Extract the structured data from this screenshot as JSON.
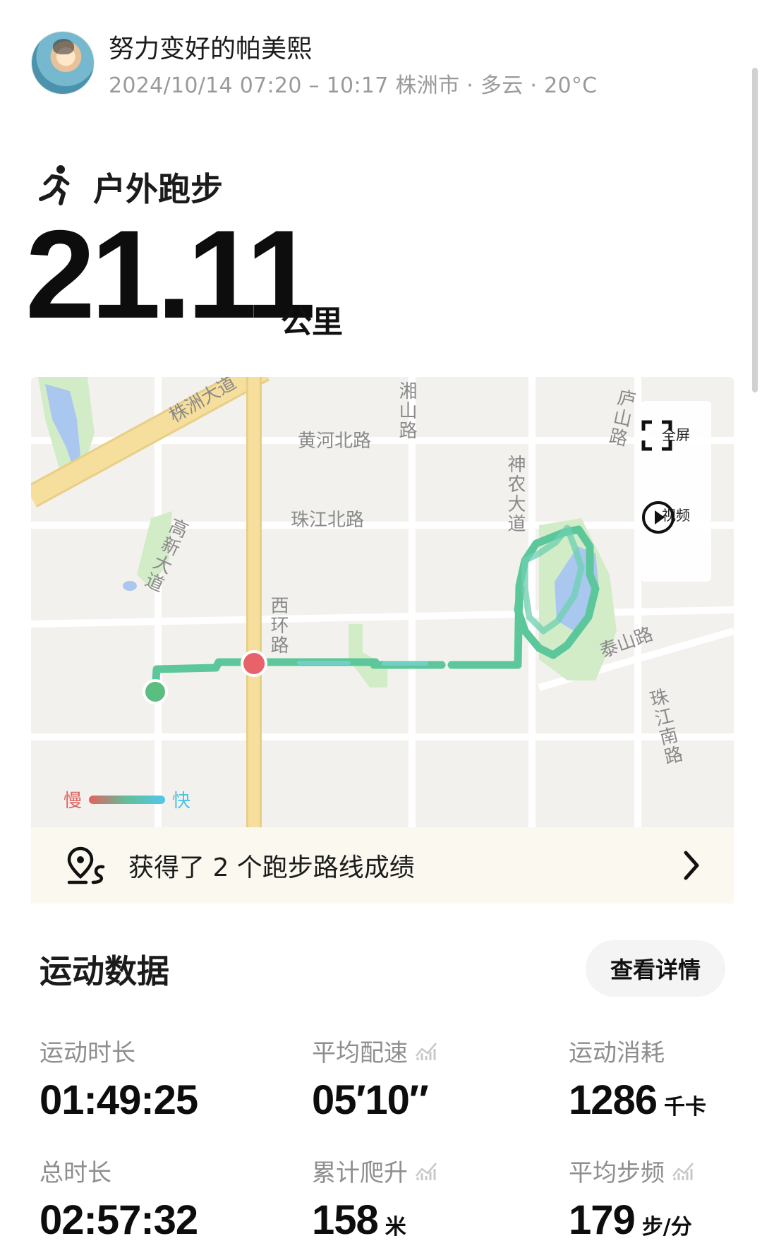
{
  "header": {
    "username": "努力变好的帕美熙",
    "time_range": "2024/10/14 07:20 – 10:17",
    "city": "株洲市",
    "weather": "多云",
    "temperature": "20°C",
    "separator": "·"
  },
  "activity": {
    "icon": "running-person-icon",
    "type": "户外跑步",
    "distance": "21.11",
    "distance_unit": "公里"
  },
  "map": {
    "road_labels": {
      "zhuzhou_ave": "株洲大道",
      "xiangshan_rd": "湘山路",
      "huanghe_north_rd": "黄河北路",
      "lushan_rd": "庐山路",
      "shennong_ave": "神农大道",
      "zhujiang_north_rd": "珠江北路",
      "gaoxin_ave": "高新大道",
      "xihuan_rd": "西环路",
      "taishan_rd": "泰山路",
      "zhujiang_south_rd": "珠江南路"
    },
    "controls": {
      "fullscreen_label": "全屏",
      "video_label": "视频"
    },
    "legend": {
      "slow": "慢",
      "fast": "快"
    },
    "colors": {
      "route": "#5cc79a",
      "start": "#5bbd7f",
      "end": "#e8626a",
      "main_road": "#f6df9c",
      "water": "#a9c7ef",
      "park": "#d3ecc8"
    }
  },
  "route_achievement": {
    "icon": "route-pin-icon",
    "text": "获得了 2 个跑步路线成绩"
  },
  "stats": {
    "section_title": "运动数据",
    "detail_button": "查看详情",
    "duration_label": "运动时长",
    "duration_value": "01:49:25",
    "pace_label": "平均配速",
    "pace_value": "05′10″",
    "calories_label": "运动消耗",
    "calories_value": "1286",
    "calories_unit": "千卡",
    "total_time_label": "总时长",
    "total_time_value": "02:57:32",
    "ascent_label": "累计爬升",
    "ascent_value": "158",
    "ascent_unit": "米",
    "cadence_label": "平均步频",
    "cadence_value": "179",
    "cadence_unit": "步/分"
  }
}
